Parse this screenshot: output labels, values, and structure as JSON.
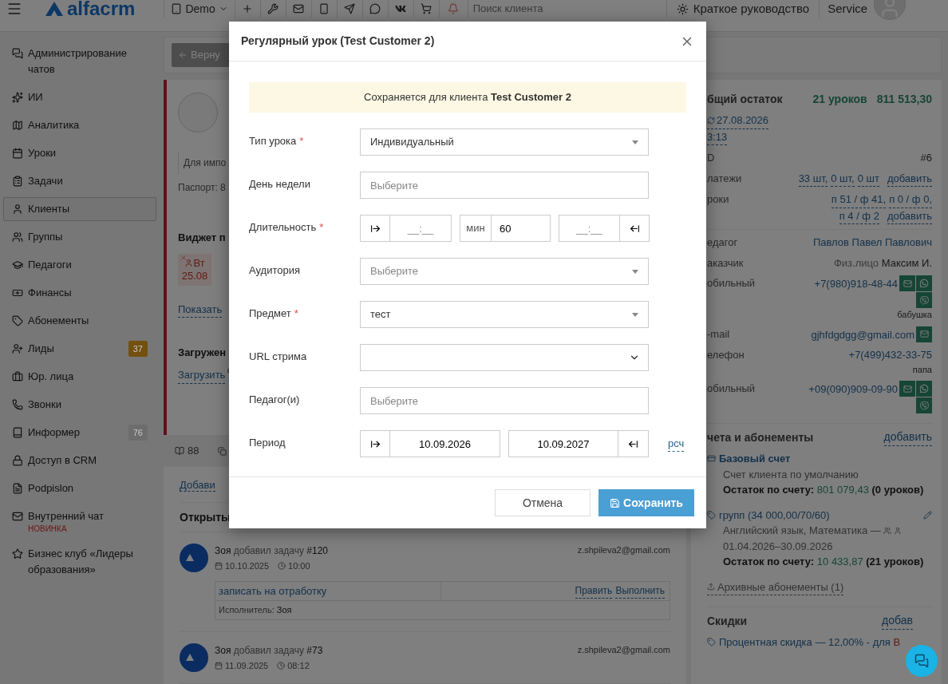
{
  "topbar": {
    "logo": "alfacrm",
    "account": "Demo",
    "search_placeholder": "Поиск клиента",
    "guide": "Краткое руководство",
    "user": "Service"
  },
  "sidebar": [
    {
      "label": "Администрирование чатов",
      "selected": false
    },
    {
      "label": "ИИ",
      "selected": false
    },
    {
      "label": "Аналитика",
      "selected": false
    },
    {
      "label": "Уроки",
      "selected": false
    },
    {
      "label": "Задачи",
      "selected": false
    },
    {
      "label": "Клиенты",
      "selected": true
    },
    {
      "label": "Группы",
      "selected": false
    },
    {
      "label": "Педагоги",
      "selected": false
    },
    {
      "label": "Финансы",
      "selected": false
    },
    {
      "label": "Абонементы",
      "selected": false
    },
    {
      "label": "Лиды",
      "selected": false,
      "badge": "37",
      "color": "#73500d"
    },
    {
      "label": "Юр. лица",
      "selected": false
    },
    {
      "label": "Звонки",
      "selected": false
    },
    {
      "label": "Информер",
      "selected": false,
      "badge": "76",
      "color": "#6d6d6d"
    },
    {
      "label": "Доступ в CRM",
      "selected": false
    },
    {
      "label": "Podpislon",
      "selected": false
    },
    {
      "label": "Внутренний чат",
      "selected": false,
      "note": "НОВИНКА"
    },
    {
      "label": "Бизнес клуб «Лидеры образования»",
      "selected": false
    }
  ],
  "client_card": {
    "back_button": "Верну",
    "note_field": "Для импо",
    "passport": "Паспорт: 8",
    "widget_title": "Виджет п",
    "lesson_chip": {
      "day": "Вт",
      "date": "25.08"
    },
    "show_link": "Показать",
    "files_title": "Загружен",
    "upload_link": "Загрузить",
    "tab_count": "88"
  },
  "activity": {
    "add_link": "Добави",
    "open_title": "Открыты",
    "tasks": [
      {
        "author": "Зоя",
        "action": "добавил задачу",
        "number": "#120",
        "date": "10.10.2025",
        "time": "10:00",
        "email": "z.shpileva2@gmail.com",
        "title": "записать на отработку",
        "edit": "Править",
        "complete": "Выполнить",
        "assignee_label": "Исполнитель:",
        "assignee": "Зоя"
      },
      {
        "author": "Зоя",
        "action": "добавил задачу",
        "number": "#73",
        "date": "11.09.2025",
        "time": "08:12",
        "email": "z.shpileva2@gmail.com"
      }
    ]
  },
  "summary": {
    "title": "бщий остаток",
    "lessons": "21 уроков",
    "amount": "811 513,30",
    "date": "27.08.2026",
    "time": "3:13",
    "rows": [
      {
        "kind": "text",
        "label": "D",
        "value": "#6"
      },
      {
        "kind": "links",
        "label": "латежи",
        "links": [
          "33 шт,",
          "0 шт,",
          "0 шт"
        ],
        "action": "добавить"
      },
      {
        "kind": "links",
        "label": "роки",
        "links": [
          "п 51 / ф 41,",
          "п 0 / ф 0,",
          "п 4 / ф 2"
        ],
        "action": "добавить"
      },
      {
        "kind": "link",
        "label": "едагог",
        "value": "Павлов Павел Павлович"
      },
      {
        "kind": "customer",
        "label": "аказчик",
        "prefix": "Физ.лицо",
        "value": "Максим И."
      },
      {
        "kind": "phone",
        "label": "обильный",
        "value": "+7(980)918-48-44",
        "note": "бабушка"
      },
      {
        "kind": "email",
        "label": "-mail",
        "value": "gjhfdgdgg@gmail.com"
      },
      {
        "kind": "link",
        "label": "елефон",
        "value": "+7(499)432-33-75",
        "note": "папа"
      },
      {
        "kind": "phone",
        "label": "обильный",
        "value": "+09(090)909-09-90"
      }
    ]
  },
  "accounts": {
    "title": "чета и абонементы",
    "add": "добавить",
    "items": [
      {
        "kind": "account",
        "name": "Базовый счет",
        "description": "Счет клиента по умолчанию",
        "balance_label": "Остаток по счету:",
        "balance": "801 079,43",
        "lessons": "(0 уроков)"
      },
      {
        "kind": "subscription",
        "name": "групп (34 000,00/70/60)",
        "description": "Английский язык, Математика —",
        "period": "01.04.2026–30.09.2026",
        "balance_label": "Остаток по счету:",
        "balance": "10 433,87",
        "lessons": "(21 уроков)"
      }
    ],
    "archive": "Архивные абонементы (1)"
  },
  "discounts": {
    "title": "Скидки",
    "add": "добав",
    "item": "Процентная скидка — 12,00% - для",
    "highlight": "В"
  },
  "modal": {
    "title": "Регулярный урок (Test Customer 2)",
    "notice": "Сохраняется для клиента **Test Customer 2**",
    "fields": [
      {
        "kind": "select",
        "label": "Тип урока",
        "mark": "*",
        "value": "Индивидуальный"
      },
      {
        "kind": "input",
        "label": "День недели",
        "placeholder": "Выберите"
      },
      {
        "kind": "duration",
        "label": "Длительность",
        "mark": "*",
        "start_placeholder": "__:__",
        "unit": "мин",
        "minutes": "60",
        "end_placeholder": "__:__"
      },
      {
        "kind": "select",
        "label": "Аудитория",
        "placeholder": "Выберите"
      },
      {
        "kind": "select",
        "label": "Предмет",
        "mark": "*",
        "value": "тест"
      },
      {
        "kind": "native_select",
        "label": "URL стрима"
      },
      {
        "kind": "input",
        "label": "Педагог(и)",
        "placeholder": "Выберите"
      },
      {
        "kind": "period",
        "label": "Период",
        "from": "10.09.2026",
        "to": "10.09.2027",
        "link": "рсч"
      }
    ],
    "cancel": "Отмена",
    "save": "Сохранить"
  }
}
